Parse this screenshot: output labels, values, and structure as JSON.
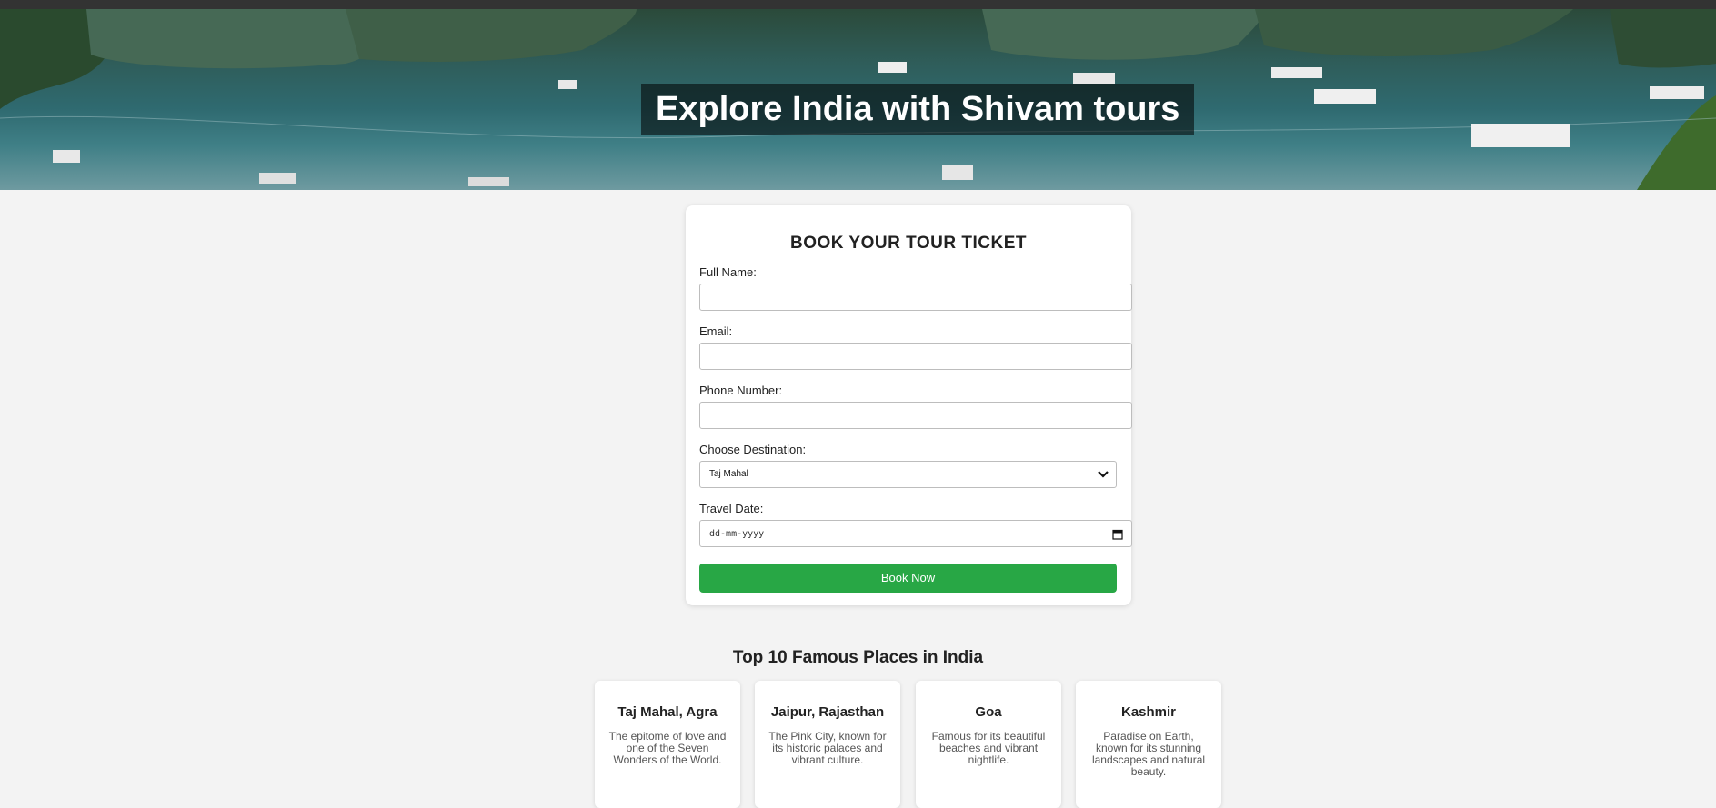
{
  "hero": {
    "title": "Explore India with Shivam tours"
  },
  "form": {
    "title": "BOOK YOUR TOUR TICKET",
    "full_name_label": "Full Name:",
    "email_label": "Email:",
    "phone_label": "Phone Number:",
    "destination_label": "Choose Destination:",
    "destination_value": "Taj Mahal",
    "date_label": "Travel Date:",
    "date_placeholder": "dd-mm-yyyy",
    "submit_label": "Book Now"
  },
  "places": {
    "title": "Top 10 Famous Places in India",
    "items": [
      {
        "name": "Taj Mahal, Agra",
        "desc": "The epitome of love and one of the Seven Wonders of the World."
      },
      {
        "name": "Jaipur, Rajasthan",
        "desc": "The Pink City, known for its historic palaces and vibrant culture."
      },
      {
        "name": "Goa",
        "desc": "Famous for its beautiful beaches and vibrant nightlife."
      },
      {
        "name": "Kashmir",
        "desc": "Paradise on Earth, known for its stunning landscapes and natural beauty."
      }
    ]
  },
  "colors": {
    "accent": "#28a745",
    "topbar": "#333333",
    "background": "#f3f3f3"
  },
  "icons": {
    "select": "chevron-down-icon",
    "date": "calendar-icon"
  }
}
